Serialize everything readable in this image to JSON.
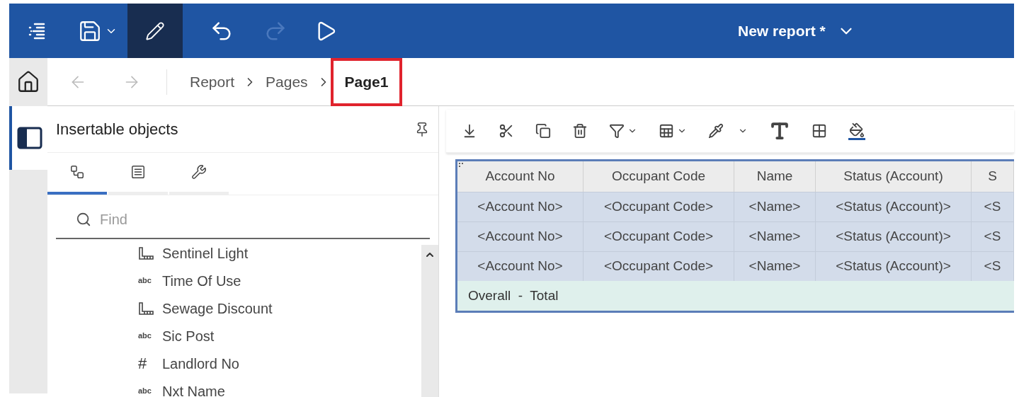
{
  "top_bar": {
    "title": "New report *",
    "redo_disabled": true,
    "edit_selected": true
  },
  "breadcrumb": [
    {
      "label": "Report",
      "current": false,
      "highlighted": false
    },
    {
      "label": "Pages",
      "current": false,
      "highlighted": false
    },
    {
      "label": "Page1",
      "current": true,
      "highlighted": true
    }
  ],
  "panel": {
    "title": "Insertable objects",
    "tabs": [
      {
        "selected": true
      },
      {
        "selected": false
      },
      {
        "selected": false
      }
    ],
    "search": {
      "placeholder": "Find"
    },
    "items": [
      {
        "kind": "measure",
        "label": "Sentinel Light"
      },
      {
        "kind": "text",
        "glyph": "abc",
        "label": "Time Of Use"
      },
      {
        "kind": "measure",
        "label": "Sewage Discount"
      },
      {
        "kind": "text",
        "glyph": "abc",
        "label": "Sic Post"
      },
      {
        "kind": "number",
        "glyph": "#",
        "label": "Landlord No"
      },
      {
        "kind": "text",
        "glyph": "abc",
        "label": "Nxt Name"
      }
    ]
  },
  "table": {
    "columns": [
      "Account No",
      "Occupant Code",
      "Name",
      "Status (Account)",
      "S"
    ],
    "rows": [
      [
        "<Account No>",
        "<Occupant Code>",
        "<Name>",
        "<Status (Account)>",
        "<S"
      ],
      [
        "<Account No>",
        "<Occupant Code>",
        "<Name>",
        "<Status (Account)>",
        "<S"
      ],
      [
        "<Account No>",
        "<Occupant Code>",
        "<Name>",
        "<Status (Account)>",
        "<S"
      ]
    ],
    "footer": "Overall  -  Total"
  }
}
